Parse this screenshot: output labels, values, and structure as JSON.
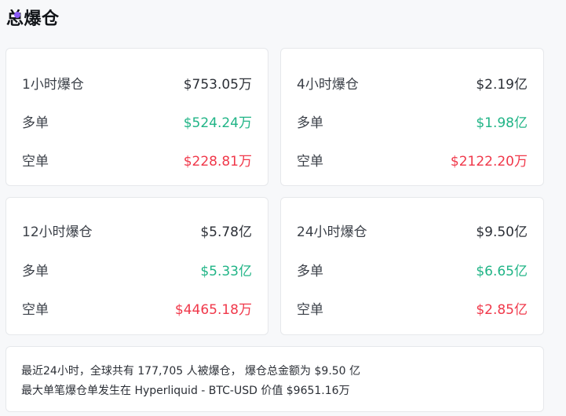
{
  "page": {
    "title": "总爆仓"
  },
  "cards": [
    {
      "period_label": "1小时爆仓",
      "total": "$753.05万",
      "long_label": "多单",
      "long_value": "$524.24万",
      "short_label": "空单",
      "short_value": "$228.81万"
    },
    {
      "period_label": "4小时爆仓",
      "total": "$2.19亿",
      "long_label": "多单",
      "long_value": "$1.98亿",
      "short_label": "空单",
      "short_value": "$2122.20万"
    },
    {
      "period_label": "12小时爆仓",
      "total": "$5.78亿",
      "long_label": "多单",
      "long_value": "$5.33亿",
      "short_label": "空单",
      "short_value": "$4465.18万"
    },
    {
      "period_label": "24小时爆仓",
      "total": "$9.50亿",
      "long_label": "多单",
      "long_value": "$6.65亿",
      "short_label": "空单",
      "short_value": "$2.85亿"
    }
  ],
  "summary": {
    "line1": "最近24小时，全球共有 177,705 人被爆仓， 爆仓总金额为 $9.50 亿",
    "line2": "最大单笔爆仓单发生在 Hyperliquid - BTC-USD 价值 $9651.16万"
  },
  "colors": {
    "long": "#20b486",
    "short": "#f0384a",
    "title_dot": "#8b5cf6"
  }
}
